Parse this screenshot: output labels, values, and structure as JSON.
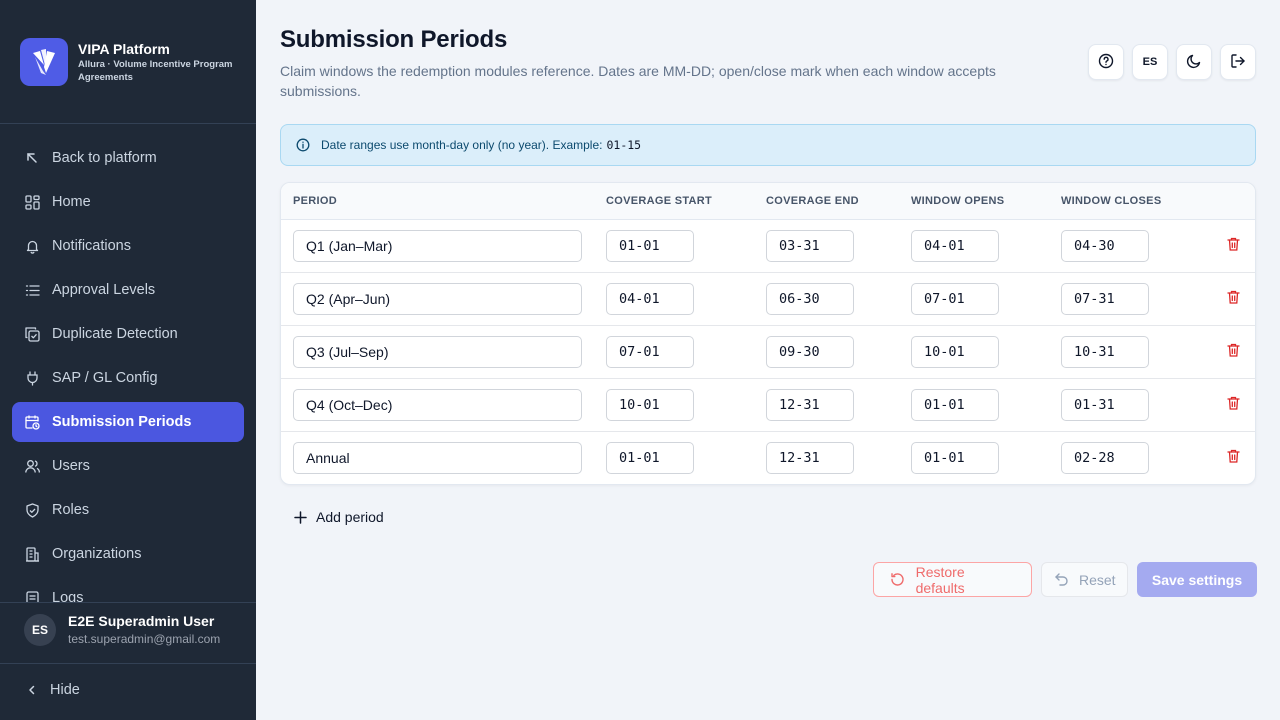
{
  "brand": {
    "title": "VIPA Platform",
    "subtitle": "Allura · Volume Incentive Program Agreements",
    "accent": "#4f5ce6"
  },
  "sidebar": {
    "items": [
      {
        "label": "Back to platform",
        "icon": "arrow-up-left-icon"
      },
      {
        "label": "Home",
        "icon": "dashboard-icon"
      },
      {
        "label": "Notifications",
        "icon": "bell-icon"
      },
      {
        "label": "Approval Levels",
        "icon": "list-icon"
      },
      {
        "label": "Duplicate Detection",
        "icon": "copy-check-icon"
      },
      {
        "label": "SAP / GL Config",
        "icon": "plug-icon"
      },
      {
        "label": "Submission Periods",
        "icon": "calendar-clock-icon",
        "active": true
      },
      {
        "label": "Users",
        "icon": "users-icon"
      },
      {
        "label": "Roles",
        "icon": "shield-check-icon"
      },
      {
        "label": "Organizations",
        "icon": "building-icon"
      },
      {
        "label": "Logs",
        "icon": "logs-icon"
      }
    ],
    "user": {
      "initials": "ES",
      "name": "E2E Superadmin User",
      "email": "test.superadmin@gmail.com"
    },
    "hide_label": "Hide"
  },
  "header": {
    "title": "Submission Periods",
    "description": "Claim windows the redemption modules reference. Dates are MM-DD; open/close mark when each window accepts submissions.",
    "language": "ES"
  },
  "info": {
    "text": "Date ranges use month-day only (no year). Example:",
    "example": "01-15"
  },
  "table": {
    "columns": [
      "PERIOD",
      "COVERAGE START",
      "COVERAGE END",
      "WINDOW OPENS",
      "WINDOW CLOSES"
    ],
    "rows": [
      {
        "period": "Q1 (Jan–Mar)",
        "coverage_start": "01-01",
        "coverage_end": "03-31",
        "window_opens": "04-01",
        "window_closes": "04-30"
      },
      {
        "period": "Q2 (Apr–Jun)",
        "coverage_start": "04-01",
        "coverage_end": "06-30",
        "window_opens": "07-01",
        "window_closes": "07-31"
      },
      {
        "period": "Q3 (Jul–Sep)",
        "coverage_start": "07-01",
        "coverage_end": "09-30",
        "window_opens": "10-01",
        "window_closes": "10-31"
      },
      {
        "period": "Q4 (Oct–Dec)",
        "coverage_start": "10-01",
        "coverage_end": "12-31",
        "window_opens": "01-01",
        "window_closes": "01-31"
      },
      {
        "period": "Annual",
        "coverage_start": "01-01",
        "coverage_end": "12-31",
        "window_opens": "01-01",
        "window_closes": "02-28"
      }
    ]
  },
  "actions": {
    "add_period": "Add period",
    "restore_defaults": "Restore defaults",
    "reset": "Reset",
    "save": "Save settings"
  },
  "colors": {
    "sidebar_bg": "#1f2937",
    "active_item": "#4b57e0",
    "danger": "#dc2626",
    "info_bg": "#dbeefa"
  }
}
